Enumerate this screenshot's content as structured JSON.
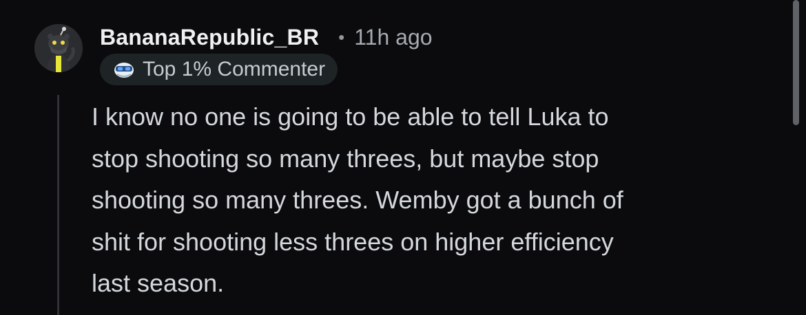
{
  "comment": {
    "author": "BananaRepublic_BR",
    "separator": "•",
    "timestamp": "11h ago",
    "badge": {
      "icon": "top-commenter-icon",
      "label": "Top 1% Commenter"
    },
    "body_lines": [
      "I know no one is going to be able to tell Luka to",
      "stop shooting so many threes, but maybe stop",
      "shooting so many threes. Wemby got a bunch of",
      "shit for shooting less threes on higher efficiency",
      "last season."
    ]
  },
  "colors": {
    "background": "#0b0b0d",
    "username": "#eef0f2",
    "body_text": "#d4d8dc",
    "badge_bg": "#1e2326",
    "thread_line": "#2f3236"
  }
}
